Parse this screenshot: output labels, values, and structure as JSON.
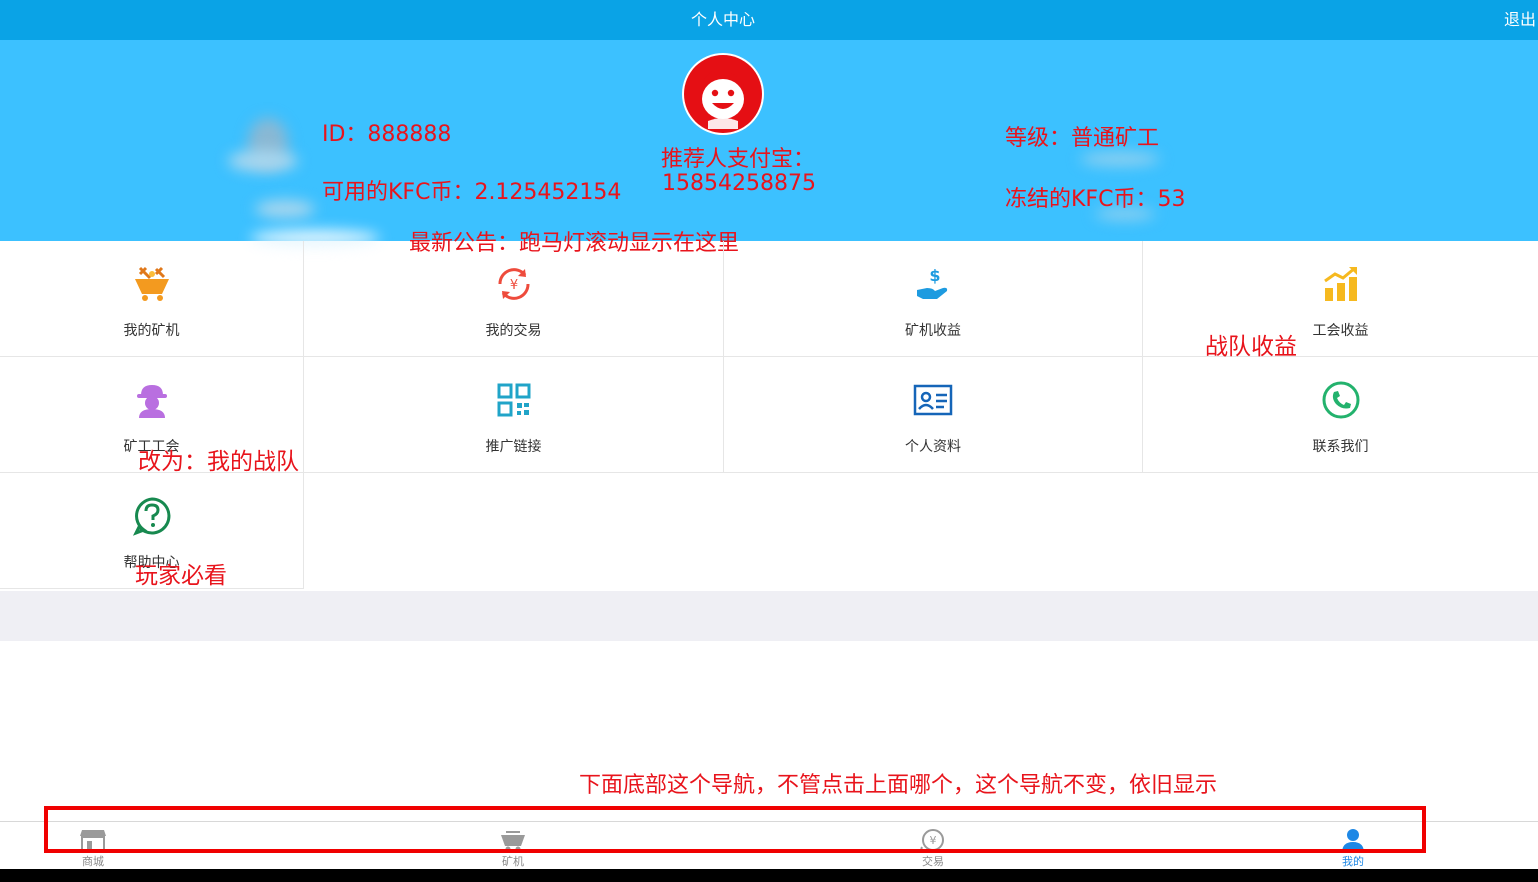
{
  "header": {
    "title": "个人中心",
    "logout_label": "退出"
  },
  "profile": {
    "id_text": "ID：888888",
    "available_coins_text": "可用的KFC币：2.125452154",
    "referrer_label": "推荐人支付宝：",
    "referrer_value": "15854258875",
    "level_text": "等级：普通矿工",
    "frozen_coins_text": "冻结的KFC币：53",
    "announcement_text": "最新公告：跑马灯滚动显示在这里"
  },
  "menu": [
    {
      "label": "我的矿机",
      "icon": "mining-cart-icon"
    },
    {
      "label": "我的交易",
      "icon": "yuan-exchange-icon"
    },
    {
      "label": "矿机收益",
      "icon": "hand-money-icon"
    },
    {
      "label": "工会收益",
      "icon": "bar-chart-icon"
    },
    {
      "label": "矿工工会",
      "icon": "miner-icon"
    },
    {
      "label": "推广链接",
      "icon": "qr-code-icon"
    },
    {
      "label": "个人资料",
      "icon": "id-card-icon"
    },
    {
      "label": "联系我们",
      "icon": "phone-icon"
    },
    {
      "label": "帮助中心",
      "icon": "help-icon"
    }
  ],
  "annotations": {
    "team_income": "战队收益",
    "rename_team": "改为：我的战队",
    "must_read": "玩家必看",
    "bottom_nav_note": "下面底部这个导航，不管点击上面哪个，这个导航不变，依旧显示"
  },
  "bottom_nav": [
    {
      "label": "商城",
      "icon": "shop-icon"
    },
    {
      "label": "矿机",
      "icon": "mine-cart-icon"
    },
    {
      "label": "交易",
      "icon": "trade-icon"
    },
    {
      "label": "我的",
      "icon": "user-icon",
      "active": true
    }
  ],
  "colors": {
    "topbar": "#0aa3e6",
    "hero": "#3cc1ff",
    "annotation_red": "#e8141c",
    "nav_active": "#1e88e5"
  }
}
